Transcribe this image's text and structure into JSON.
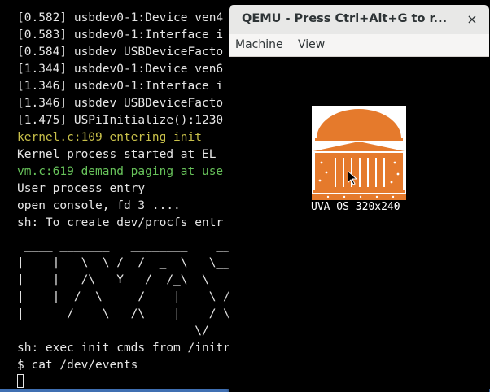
{
  "terminal": {
    "lines": [
      "[0.582] usbdev0-1:Device ven4",
      "[0.583] usbdev0-1:Interface i",
      "[0.584] usbdev USBDeviceFacto",
      "[1.344] usbdev0-1:Device ven6",
      "[1.346] usbdev0-1:Interface i",
      "[1.346] usbdev USBDeviceFacto",
      "[1.475] USPiInitialize():1230",
      "kernel.c:109 entering init",
      "Kernel process started at EL",
      "vm.c:619 demand paging at use",
      "User process entry",
      "open console, fd 3 ....",
      "sh: To create dev/procfs entr"
    ],
    "ascii_art": " ____ _______   ________    ________     _________\n|    |   \\  \\ /  /  _  \\   \\_____  \\   /   _____/\n|    |   /\\   Y   /  /_\\  \\   /   |   \\  \\_____  \\ \n|    |  /  \\     /    |    \\ /    |    \\ /        \\\n|______/    \\___/\\____|__  / \\_______  //_______  /\n                         \\/          \\/         \\/ ",
    "exec_line": "sh: exec init cmds from /initrc.txt...",
    "prompt_line": "$ cat /dev/events"
  },
  "qemu": {
    "title": "QEMU - Press Ctrl+Alt+G to r...",
    "close_symbol": "×",
    "menu": [
      "Machine",
      "View"
    ],
    "logo_caption": "UVA OS 320x240",
    "logo_color": "#e57a2c"
  }
}
